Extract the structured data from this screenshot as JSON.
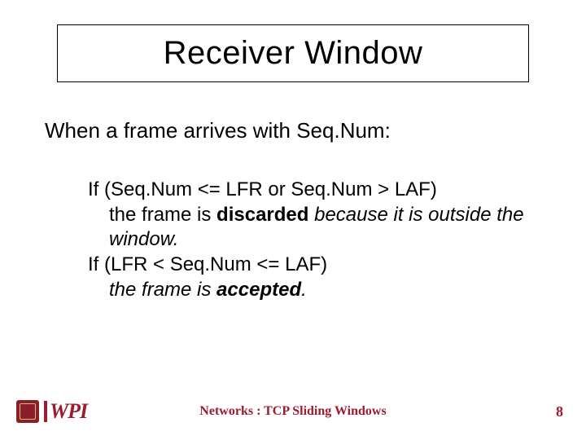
{
  "title": "Receiver Window",
  "intro": "When a frame arrives with Seq.Num:",
  "body": {
    "cond1": "If  (Seq.Num <= LFR or Seq.Num > LAF)",
    "res1a": "the frame is ",
    "res1b": "discarded",
    "res1c": "  because it is outside the window.",
    "cond2": "If  (LFR < Seq.Num <=  LAF)",
    "res2a": "the frame is ",
    "res2b": "accepted",
    "res2c": "."
  },
  "footer": {
    "logo_text": "WPI",
    "title": "Networks : TCP Sliding Windows",
    "page": "8"
  }
}
